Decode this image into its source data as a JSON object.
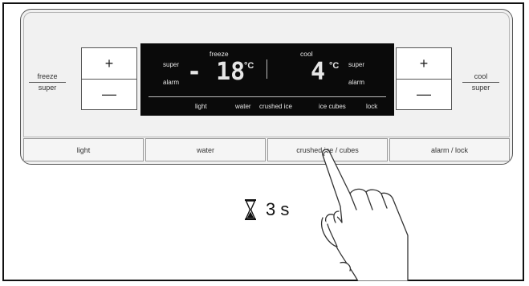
{
  "left": {
    "label_top": "freeze",
    "label_bottom": "super",
    "plus": "+",
    "minus": "—"
  },
  "right": {
    "label_top": "cool",
    "label_bottom": "super",
    "plus": "+",
    "minus": "—"
  },
  "display": {
    "freeze_label": "freeze",
    "cool_label": "cool",
    "left_super": "super",
    "left_alarm": "alarm",
    "freeze_value": "- 18",
    "freeze_unit": "°C",
    "cool_value": "4",
    "cool_unit": "°C",
    "right_super": "super",
    "right_alarm": "alarm",
    "bottom_items": [
      "light",
      "water",
      "crushed ice",
      "ice cubes",
      "lock"
    ]
  },
  "buttons": [
    "light",
    "water",
    "crushed ice / cubes",
    "alarm / lock"
  ],
  "timer": {
    "text": "3 s",
    "icon": "hourglass-icon"
  },
  "hand": {
    "icon": "pointing-hand-icon"
  }
}
